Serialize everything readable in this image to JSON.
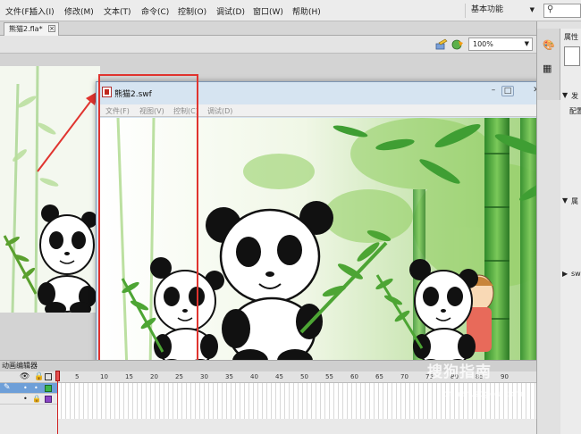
{
  "menu": {
    "items": [
      "文件(F)",
      "插入(I)",
      "修改(M)",
      "文本(T)",
      "命令(C)",
      "控制(O)",
      "调试(D)",
      "窗口(W)",
      "帮助(H)"
    ],
    "workspace": "基本功能"
  },
  "document": {
    "tab_title": "熊猫2.fla*"
  },
  "editbar": {
    "zoom": "100%"
  },
  "player": {
    "title": "熊猫2.swf",
    "menu": [
      "文件(F)",
      "视图(V)",
      "控制(C)",
      "调试(D)"
    ]
  },
  "timeline": {
    "panel_title": "动画编辑器",
    "frame_numbers": [
      "5",
      "10",
      "15",
      "20",
      "25",
      "30",
      "35",
      "40",
      "45",
      "50",
      "55",
      "60",
      "65",
      "70",
      "75",
      "80",
      "85",
      "90"
    ]
  },
  "right_panel": {
    "properties_label": "属性",
    "label_2": "发",
    "label_3": "配置",
    "label_4": "属",
    "label_5": "sw"
  },
  "watermark": {
    "text": "搜狗指南",
    "url": "zhinan.sogou.com"
  },
  "colors": {
    "highlight": "#e0342f",
    "arrow": "#e0342f",
    "layer_green": "#3bb54a",
    "layer_purple": "#8a45c6",
    "bamboo": "#6fc24a",
    "sky": "#eef6e4"
  }
}
